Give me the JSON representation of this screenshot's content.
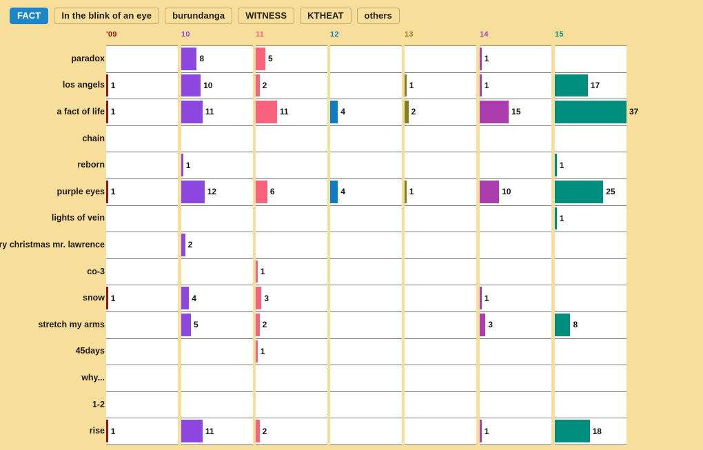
{
  "page": {
    "background_color": "#F7DE9B",
    "panel_color": "#FFFFFF"
  },
  "tabs": [
    {
      "label": "FACT",
      "active": true
    },
    {
      "label": "In the blink of an eye",
      "active": false
    },
    {
      "label": "burundanga",
      "active": false
    },
    {
      "label": "WITNESS",
      "active": false
    },
    {
      "label": "KTHEAT",
      "active": false
    },
    {
      "label": "others",
      "active": false
    }
  ],
  "chart_data": {
    "type": "bar",
    "title": "",
    "xlabel": "",
    "ylabel": "",
    "grid": true,
    "legend_position": "none",
    "orientation": "horizontal",
    "layout": "small-multiples-by-year",
    "categories": [
      "paradox",
      "los angels",
      "a fact of life",
      "chain",
      "reborn",
      "purple eyes",
      "lights of vein",
      "merry christmas mr. lawrence",
      "co-3",
      "snow",
      "stretch my arms",
      "45days",
      "why...",
      "1-2",
      "rise"
    ],
    "x": [
      "'09",
      "10",
      "11",
      "12",
      "13",
      "14",
      "15"
    ],
    "column_colors": [
      "#8C1818",
      "#8B47E0",
      "#F9627D",
      "#0C7FC4",
      "#80801A",
      "#AC3DAE",
      "#008F7E"
    ],
    "column_label_colors": [
      "#8C1818",
      "#8B47E0",
      "#F9627D",
      "#0C7FC4",
      "#80801A",
      "#AC3DAE",
      "#008F7E"
    ],
    "max_value": 37,
    "series": [
      {
        "name": "'09",
        "values": [
          0,
          1,
          1,
          0,
          0,
          1,
          0,
          0,
          0,
          1,
          0,
          0,
          0,
          0,
          1
        ]
      },
      {
        "name": "10",
        "values": [
          8,
          10,
          11,
          0,
          1,
          12,
          0,
          2,
          0,
          4,
          5,
          0,
          0,
          0,
          11
        ]
      },
      {
        "name": "11",
        "values": [
          5,
          2,
          11,
          0,
          0,
          6,
          0,
          0,
          1,
          3,
          2,
          1,
          0,
          0,
          2
        ]
      },
      {
        "name": "12",
        "values": [
          0,
          0,
          4,
          0,
          0,
          4,
          0,
          0,
          0,
          0,
          0,
          0,
          0,
          0,
          0
        ]
      },
      {
        "name": "13",
        "values": [
          0,
          1,
          2,
          0,
          0,
          1,
          0,
          0,
          0,
          0,
          0,
          0,
          0,
          0,
          0
        ]
      },
      {
        "name": "14",
        "values": [
          1,
          1,
          15,
          0,
          0,
          10,
          0,
          0,
          0,
          1,
          3,
          0,
          0,
          0,
          1
        ]
      },
      {
        "name": "15",
        "values": [
          0,
          17,
          37,
          0,
          1,
          25,
          1,
          0,
          0,
          0,
          8,
          0,
          0,
          0,
          18
        ]
      }
    ]
  }
}
